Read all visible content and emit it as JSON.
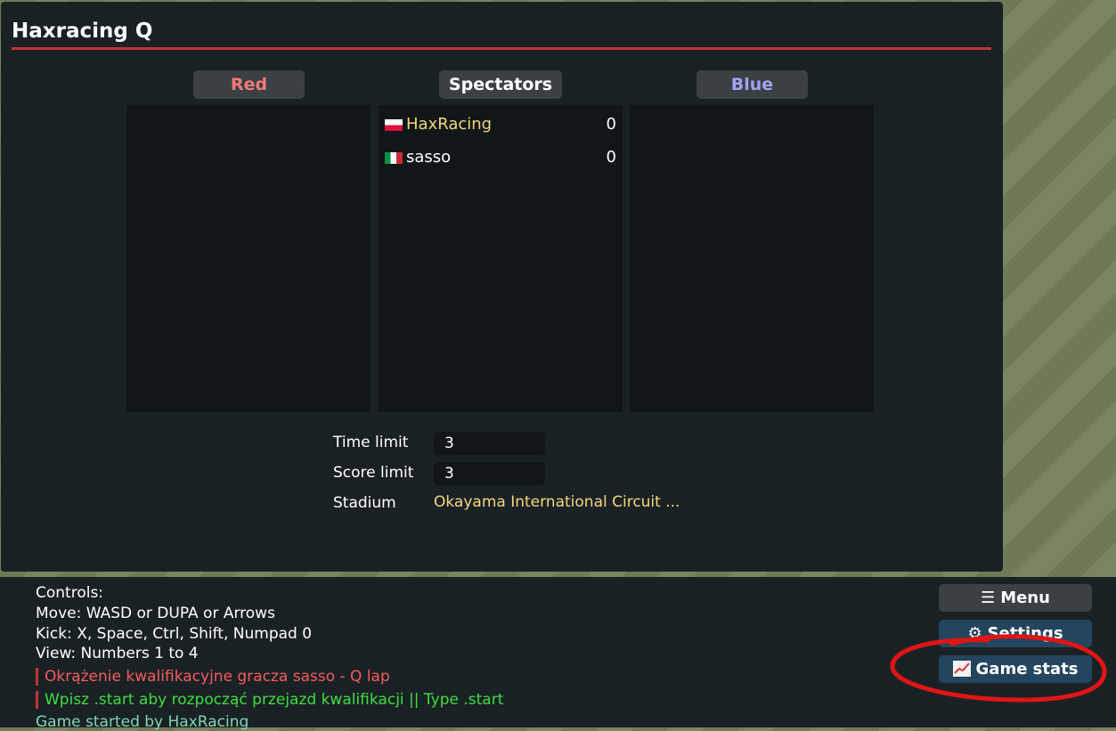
{
  "room": {
    "title": "Haxracing Q"
  },
  "teams": {
    "red_label": "Red",
    "spectators_label": "Spectators",
    "blue_label": "Blue",
    "spectators": [
      {
        "name": "HaxRacing",
        "score": "0",
        "flag": "pl-flag-icon",
        "name_color": "#f5d67a"
      },
      {
        "name": "sasso",
        "score": "0",
        "flag": "it-flag-icon",
        "name_color": "#ffffff"
      }
    ]
  },
  "settings": {
    "time_limit_label": "Time limit",
    "time_limit_value": "3",
    "score_limit_label": "Score limit",
    "score_limit_value": "3",
    "stadium_label": "Stadium",
    "stadium_value": "Okayama International Circuit ..."
  },
  "chat": {
    "lines": [
      "Controls:",
      "Move: WASD or DUPA or Arrows",
      "Kick: X, Space, Ctrl, Shift, Numpad 0",
      "View: Numbers 1 to 4"
    ],
    "announcement_red": "Okrążenie kwalifikacyjne gracza sasso - Q lap",
    "announcement_green": "Wpisz .start aby rozpocząć przejazd kwalifikacji || Type .start",
    "last_line": "Game started by HaxRacing"
  },
  "buttons": {
    "menu_label": "Menu",
    "menu_icon": "hamburger-icon",
    "settings_label": "Settings",
    "settings_icon": "gear-icon",
    "game_stats_label": "Game stats",
    "game_stats_icon": "chart-increasing-icon"
  },
  "colors": {
    "accent_red": "#c13535",
    "annotation": "#e01515",
    "stadium_text": "#f5d67a"
  }
}
